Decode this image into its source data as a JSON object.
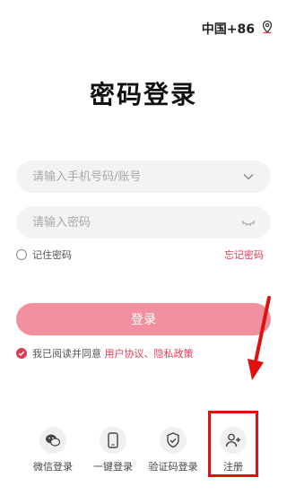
{
  "region": {
    "label": "中国+86",
    "icon": "location-pin-icon"
  },
  "title": "密码登录",
  "account": {
    "placeholder": "请输入手机号码/账号",
    "value": "",
    "icon": "chevron-down-icon"
  },
  "password": {
    "placeholder": "请输入密码",
    "value": "",
    "icon": "eye-closed-icon"
  },
  "remember": {
    "label": "记住密码",
    "checked": false
  },
  "forgot": "忘记密码",
  "login_button": "登录",
  "agreement": {
    "checked": true,
    "text": "我已阅读并同意",
    "user_agreement": "用户协议",
    "separator": "、",
    "privacy_policy": "隐私政策"
  },
  "bottom_options": [
    {
      "label": "微信登录",
      "icon": "wechat-icon"
    },
    {
      "label": "一键登录",
      "icon": "phone-icon"
    },
    {
      "label": "验证码登录",
      "icon": "shield-check-icon"
    },
    {
      "label": "注册",
      "icon": "add-user-icon"
    }
  ],
  "colors": {
    "accent": "#e03b56",
    "button": "#f2909f",
    "annotation": "#e01010"
  }
}
